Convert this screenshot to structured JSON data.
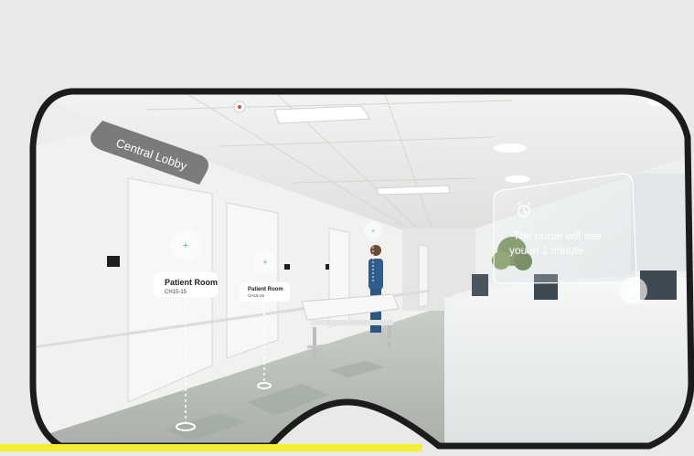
{
  "scene": {
    "area_sign": "Central Lobby",
    "rooms": [
      {
        "title": "Patient Room",
        "code": "CH15-15"
      },
      {
        "title": "Patient Room",
        "code": "CH15-16"
      }
    ],
    "notification": {
      "icon": "alarm-clock-icon",
      "line1": "The nurse will see",
      "line2": "you in 1 minute."
    }
  },
  "colors": {
    "background": "#e9e9e9",
    "headset_frame": "#1c1c1c",
    "highlight": "#f4f02a"
  }
}
